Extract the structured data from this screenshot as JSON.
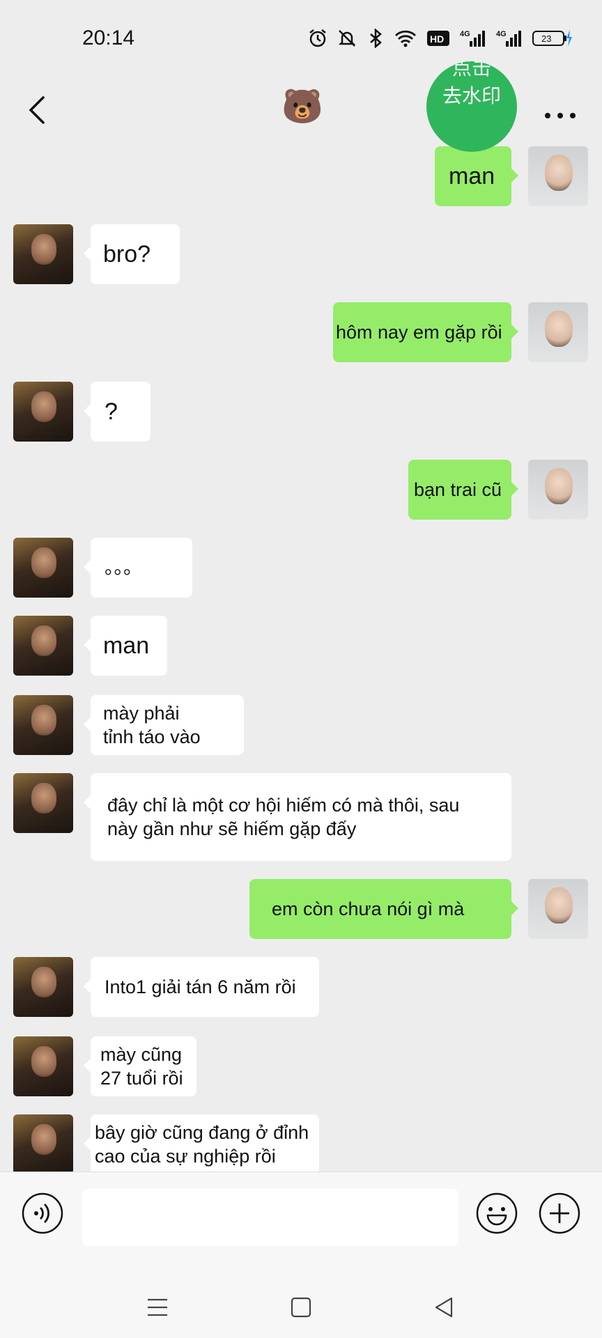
{
  "status_bar": {
    "time": "20:14",
    "icons": [
      "alarm-icon",
      "mute-icon",
      "bluetooth-icon",
      "wifi-icon",
      "hd-icon",
      "signal-icon",
      "signal-icon"
    ],
    "network_1": "4G",
    "network_2": "4G",
    "hd_label": "HD",
    "battery": "23"
  },
  "header": {
    "title_emoji": "🐻",
    "watermark_button_line1": "点击",
    "watermark_button_line2": "去水印"
  },
  "messages": [
    {
      "side": "right",
      "text": "man"
    },
    {
      "side": "left",
      "text": "bro?"
    },
    {
      "side": "right",
      "text": "hôm nay em gặp rồi"
    },
    {
      "side": "left",
      "text": "?"
    },
    {
      "side": "right",
      "text": "bạn trai cũ"
    },
    {
      "side": "left",
      "text": "。。。"
    },
    {
      "side": "left",
      "text": "man"
    },
    {
      "side": "left",
      "text": "mày phải\ntỉnh táo vào"
    },
    {
      "side": "left",
      "text": "đây chỉ là một cơ hội hiếm có mà thôi, sau\nnày gần như sẽ hiếm gặp đấy"
    },
    {
      "side": "right",
      "text": "em còn chưa nói gì mà"
    },
    {
      "side": "left",
      "text": "Into1 giải tán 6 năm rồi"
    },
    {
      "side": "left",
      "text": "mày cũng\n27 tuổi rồi"
    },
    {
      "side": "left",
      "text": "bây giờ cũng đang ở đỉnh\ncao của sự nghiệp rồi"
    }
  ],
  "input": {
    "value": "",
    "placeholder": ""
  },
  "colors": {
    "background": "#ededed",
    "sent_bubble": "#95ec69",
    "received_bubble": "#ffffff",
    "watermark_button": "#2fb55c"
  }
}
